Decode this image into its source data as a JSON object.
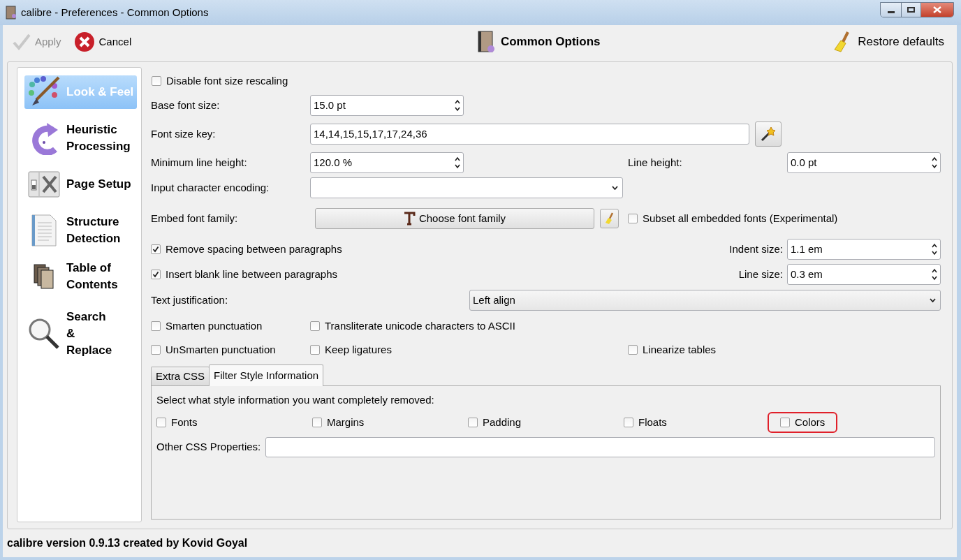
{
  "window": {
    "title": "calibre - Preferences - Common Options"
  },
  "toolbar": {
    "apply": {
      "label": "Apply",
      "disabled": true
    },
    "cancel": {
      "label": "Cancel",
      "disabled": false
    },
    "heading": "Common Options",
    "restore": {
      "label": "Restore defaults"
    }
  },
  "sidebar": {
    "items": [
      {
        "kind": "palette",
        "label": "Look & Feel",
        "selected": true
      },
      {
        "kind": "redo",
        "label": "Heuristic\nProcessing",
        "selected": false
      },
      {
        "kind": "tools",
        "label": "Page Setup",
        "selected": false
      },
      {
        "kind": "document",
        "label": "Structure\nDetection",
        "selected": false
      },
      {
        "kind": "books",
        "label": "Table of\nContents",
        "selected": false
      },
      {
        "kind": "search",
        "label": "Search\n&\nReplace",
        "selected": false
      }
    ]
  },
  "form": {
    "disable_rescaling": {
      "label": "Disable font size rescaling",
      "checked": false
    },
    "base_font_size": {
      "label": "Base font size:",
      "value": "15.0 pt"
    },
    "font_size_key": {
      "label": "Font size key:",
      "value": "14,14,15,15,17,17,24,36"
    },
    "minimum_line_height": {
      "label": "Minimum line height:",
      "value": "120.0 %"
    },
    "line_height": {
      "label": "Line height:",
      "value": "0.0 pt"
    },
    "input_encoding": {
      "label": "Input character encoding:"
    },
    "embed_font_family": {
      "label": "Embed font family:",
      "button": "Choose font family"
    },
    "subset_fonts": {
      "label": "Subset all embedded fonts (Experimental)",
      "checked": false
    },
    "remove_spacing": {
      "label": "Remove spacing between paragraphs",
      "checked": true
    },
    "indent_size": {
      "label": "Indent size:",
      "value": "1.1 em"
    },
    "insert_blank_line": {
      "label": "Insert blank line between paragraphs",
      "checked": true
    },
    "line_size": {
      "label": "Line size:",
      "value": "0.3 em"
    },
    "text_justification": {
      "label": "Text justification:",
      "value": "Left align"
    },
    "smarten": {
      "label": "Smarten punctuation",
      "checked": false
    },
    "transliterate": {
      "label": "Transliterate unicode characters to ASCII",
      "checked": false
    },
    "unsmarten": {
      "label": "UnSmarten punctuation",
      "checked": false
    },
    "keep_ligatures": {
      "label": "Keep ligatures",
      "checked": false
    },
    "linearize_tables": {
      "label": "Linearize tables",
      "checked": false
    }
  },
  "tabs": [
    {
      "label": "Extra CSS",
      "selected": false
    },
    {
      "label": "Filter Style Information",
      "selected": true
    }
  ],
  "filter": {
    "prompt": "Select what style information you want completely removed:",
    "options": [
      {
        "label": "Fonts",
        "checked": false,
        "highlighted": false
      },
      {
        "label": "Margins",
        "checked": false,
        "highlighted": false
      },
      {
        "label": "Padding",
        "checked": false,
        "highlighted": false
      },
      {
        "label": "Floats",
        "checked": false,
        "highlighted": false
      },
      {
        "label": "Colors",
        "checked": false,
        "highlighted": true
      }
    ],
    "other_css": {
      "label": "Other CSS Properties:"
    }
  },
  "status_bar": "calibre version 0.9.13 created by Kovid Goyal"
}
